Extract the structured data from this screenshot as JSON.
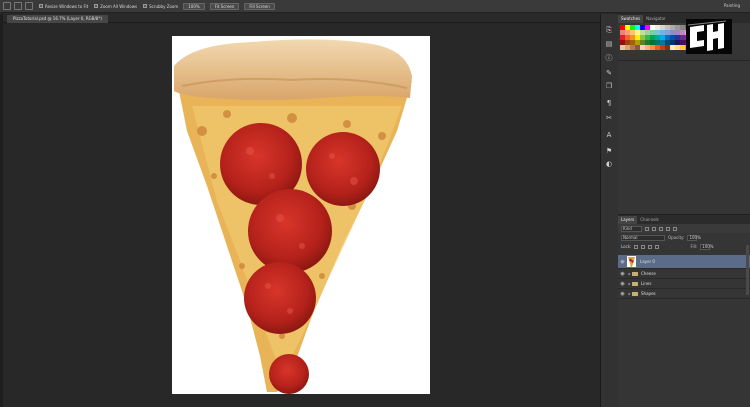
{
  "options_bar": {
    "checks": [
      {
        "label": "Resize Windows to Fit"
      },
      {
        "label": "Zoom All Windows"
      },
      {
        "label": "Scrubby Zoom"
      }
    ],
    "buttons": [
      "100%",
      "Fit Screen",
      "Fill Screen"
    ],
    "workspace": "Painting"
  },
  "document_tab": {
    "title": "PizzaTutorial.psd @ 16.7% (Layer 0, RGB/8*)"
  },
  "panels": {
    "top_tabs": [
      "Swatches",
      "Navigator"
    ],
    "layers_tabs": [
      "Layers",
      "Channels"
    ],
    "kind_label": "Kind",
    "blend_mode": "Normal",
    "opacity_label": "Opacity:",
    "opacity_value": "100%",
    "lock_label": "Lock:",
    "fill_label": "Fill:",
    "fill_value": "100%"
  },
  "layers": [
    {
      "name": "Layer 0",
      "type": "pixel",
      "visible": true,
      "selected": true
    },
    {
      "name": "Cheese",
      "type": "group",
      "visible": true,
      "selected": false
    },
    {
      "name": "Lines",
      "type": "group",
      "visible": true,
      "selected": false
    },
    {
      "name": "Shapes",
      "type": "group",
      "visible": true,
      "selected": false
    }
  ],
  "logo": {
    "text": "CH"
  },
  "colors": {
    "canvas_bg": "#ffffff",
    "workspace_bg": "#282828",
    "selected_layer": "#5b6c8a"
  }
}
